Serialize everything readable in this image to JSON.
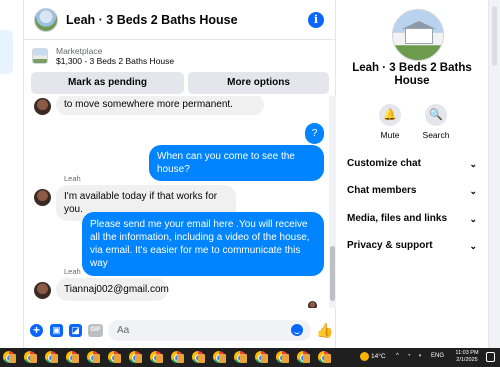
{
  "chat": {
    "title": "Leah · 3 Beds 2 Baths House",
    "info_icon": "info-icon",
    "info_glyph": "i"
  },
  "marketplace": {
    "label": "Marketplace",
    "listing": "$1,300 - 3 Beds 2 Baths House",
    "mark_pending": "Mark as pending",
    "more_options": "More options"
  },
  "messages": {
    "m1": "to move somewhere more permanent.",
    "m2": "?",
    "m3": "When can you come to see the house?",
    "sender_a": "Leah",
    "m4": "I'm available today if that works for you.",
    "m5": "Please send me your email here .You will receive all the information, including a video of the house, via email. It's easier for me to communicate this way",
    "sender_b": "Leah",
    "m6": "Tiannaj002@gmail.com"
  },
  "composer": {
    "placeholder": "Aa",
    "gif_label": "GIF",
    "plus_glyph": "+",
    "like_glyph": "👍"
  },
  "profile": {
    "name": "Leah · 3 Beds 2 Baths House",
    "mute_label": "Mute",
    "search_label": "Search",
    "mute_glyph": "🔔",
    "search_glyph": "🔍",
    "chevron": "⌄",
    "menu": [
      "Customize chat",
      "Chat members",
      "Media, files and links",
      "Privacy & support"
    ]
  },
  "taskbar": {
    "temperature": "14°C",
    "language": "ENG",
    "time": "11:03 PM",
    "date": "2/1/2025",
    "tray_up": "^",
    "tray_wifi": "◔",
    "tray_sound": "◖"
  },
  "colors": {
    "accent": "#0866ff",
    "outgoing_bubble": "#0084ff",
    "incoming_bubble": "#f0f0f0",
    "taskbar": "#1f1f1f"
  }
}
